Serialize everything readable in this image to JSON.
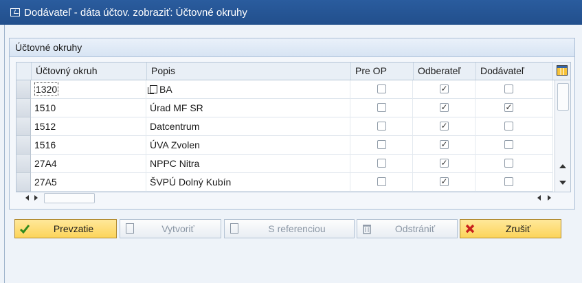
{
  "window": {
    "title": "Dodávateľ - dáta účtov. zobraziť: Účtovné okruhy"
  },
  "group": {
    "title": "Účtovné okruhy"
  },
  "table": {
    "headers": [
      "Účtovný okruh",
      "Popis",
      "Pre OP",
      "Odberateľ",
      "Dodávateľ"
    ],
    "rows": [
      {
        "code": "1320",
        "desc": "BA",
        "pre_op": false,
        "odberatel": true,
        "dodavatel": false
      },
      {
        "code": "1510",
        "desc": "Úrad MF SR",
        "pre_op": false,
        "odberatel": true,
        "dodavatel": true
      },
      {
        "code": "1512",
        "desc": "Datcentrum",
        "pre_op": false,
        "odberatel": true,
        "dodavatel": false
      },
      {
        "code": "1516",
        "desc": "ÚVA Zvolen",
        "pre_op": false,
        "odberatel": true,
        "dodavatel": false
      },
      {
        "code": "27A4",
        "desc": "NPPC Nitra",
        "pre_op": false,
        "odberatel": true,
        "dodavatel": false
      },
      {
        "code": "27A5",
        "desc": "ŠVPÚ Dolný Kubín",
        "pre_op": false,
        "odberatel": true,
        "dodavatel": false
      }
    ],
    "check_mark": "✓"
  },
  "buttons": {
    "prevzatie": "Prevzatie",
    "vytvorit": "Vytvoriť",
    "s_referenciou": "S referenciou",
    "odstranit": "Odstrániť",
    "zrusit": "Zrušiť"
  },
  "colors": {
    "title_bar": "#2a5c9e",
    "accent_button": "#fcd45a"
  },
  "icons": {
    "title": "window-icon",
    "column_settings": "column-layout-icon",
    "prevzatie": "green-check-icon",
    "vytvorit": "blank-document-icon",
    "s_referenciou": "document-icon",
    "odstranit": "trash-icon",
    "zrusit": "red-x-icon"
  }
}
